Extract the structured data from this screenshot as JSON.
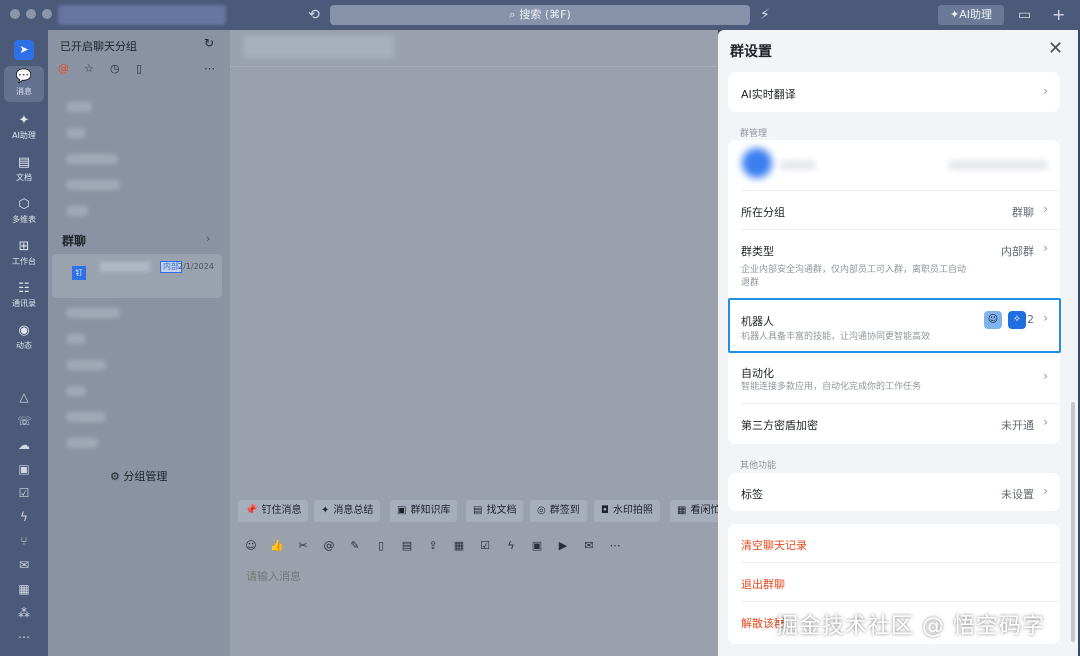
{
  "titlebar": {
    "search_placeholder": "搜索 (⌘F)",
    "ai_button": "AI助理"
  },
  "nav": {
    "items": [
      {
        "label": "消息",
        "icon": "chat-icon"
      },
      {
        "label": "AI助理",
        "icon": "sparkle-icon"
      },
      {
        "label": "文档",
        "icon": "doc-icon"
      },
      {
        "label": "多维表",
        "icon": "table-icon"
      },
      {
        "label": "工作台",
        "icon": "grid-icon"
      },
      {
        "label": "通讯录",
        "icon": "contacts-icon"
      },
      {
        "label": "动态",
        "icon": "eye-icon"
      }
    ]
  },
  "chatlist": {
    "title": "已开启聊天分组",
    "section": "群聊",
    "chat_badge": "内部",
    "chat_date": "2/1/2024",
    "chat_avatar": "钉",
    "group_manage": "分组管理"
  },
  "main": {
    "quick_actions": [
      "钉住消息",
      "消息总结",
      "群知识库",
      "找文档",
      "群签到",
      "水印拍照",
      "看闲忙"
    ],
    "input_placeholder": "请输入消息"
  },
  "panel": {
    "title": "群设置",
    "rows": {
      "ai_translate": "AI实时翻译",
      "section_manage": "群管理",
      "group_label": "所在分组",
      "group_value": "群聊",
      "type_label": "群类型",
      "type_value": "内部群",
      "type_desc": "企业内部安全沟通群，仅内部员工可入群，离职员工自动退群",
      "robot_label": "机器人",
      "robot_desc": "机器人具备丰富的技能，让沟通协同更智能高效",
      "robot_count": "2",
      "auto_label": "自动化",
      "auto_desc": "智能连接多款应用，自动化完成你的工作任务",
      "encrypt_label": "第三方密盾加密",
      "encrypt_value": "未开通",
      "section_other": "其他功能",
      "tag_label": "标签",
      "tag_value": "未设置"
    },
    "danger": {
      "clear": "清空聊天记录",
      "quit": "退出群聊",
      "dissolve": "解散该群"
    }
  },
  "watermark": "掘金技术社区 @ 悟空码字"
}
